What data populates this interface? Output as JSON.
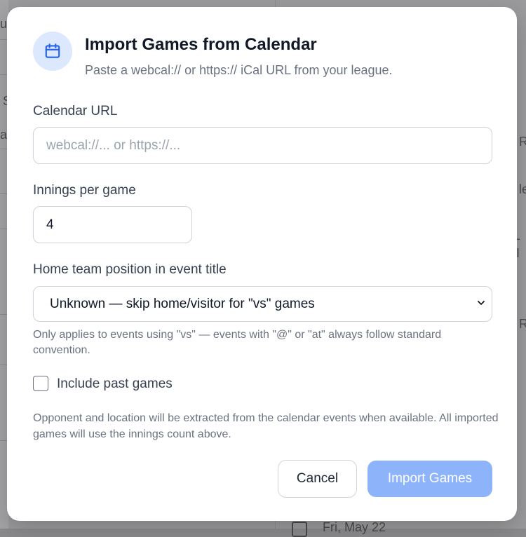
{
  "background": {
    "fragments": [
      "u",
      "S",
      "a",
      "R",
      "le",
      "- I",
      "R"
    ],
    "bottom_row_text": "Fri, May 22"
  },
  "dialog": {
    "title": "Import Games from Calendar",
    "subtitle": "Paste a webcal:// or https:// iCal URL from your league.",
    "header_icon": "calendar-icon",
    "calendar_url": {
      "label": "Calendar URL",
      "value": "",
      "placeholder": "webcal://... or https://..."
    },
    "innings": {
      "label": "Innings per game",
      "value": "4"
    },
    "home_position": {
      "label": "Home team position in event title",
      "selected": "Unknown — skip home/visitor for \"vs\" games",
      "hint": "Only applies to events using \"vs\" — events with \"@\" or \"at\" always follow standard convention."
    },
    "include_past": {
      "label": "Include past games",
      "checked": false
    },
    "info_text": "Opponent and location will be extracted from the calendar events when available. All imported games will use the innings count above.",
    "cancel_label": "Cancel",
    "import_label": "Import Games",
    "accent_color": "#2563eb",
    "primary_button_color": "#8db3fb"
  }
}
